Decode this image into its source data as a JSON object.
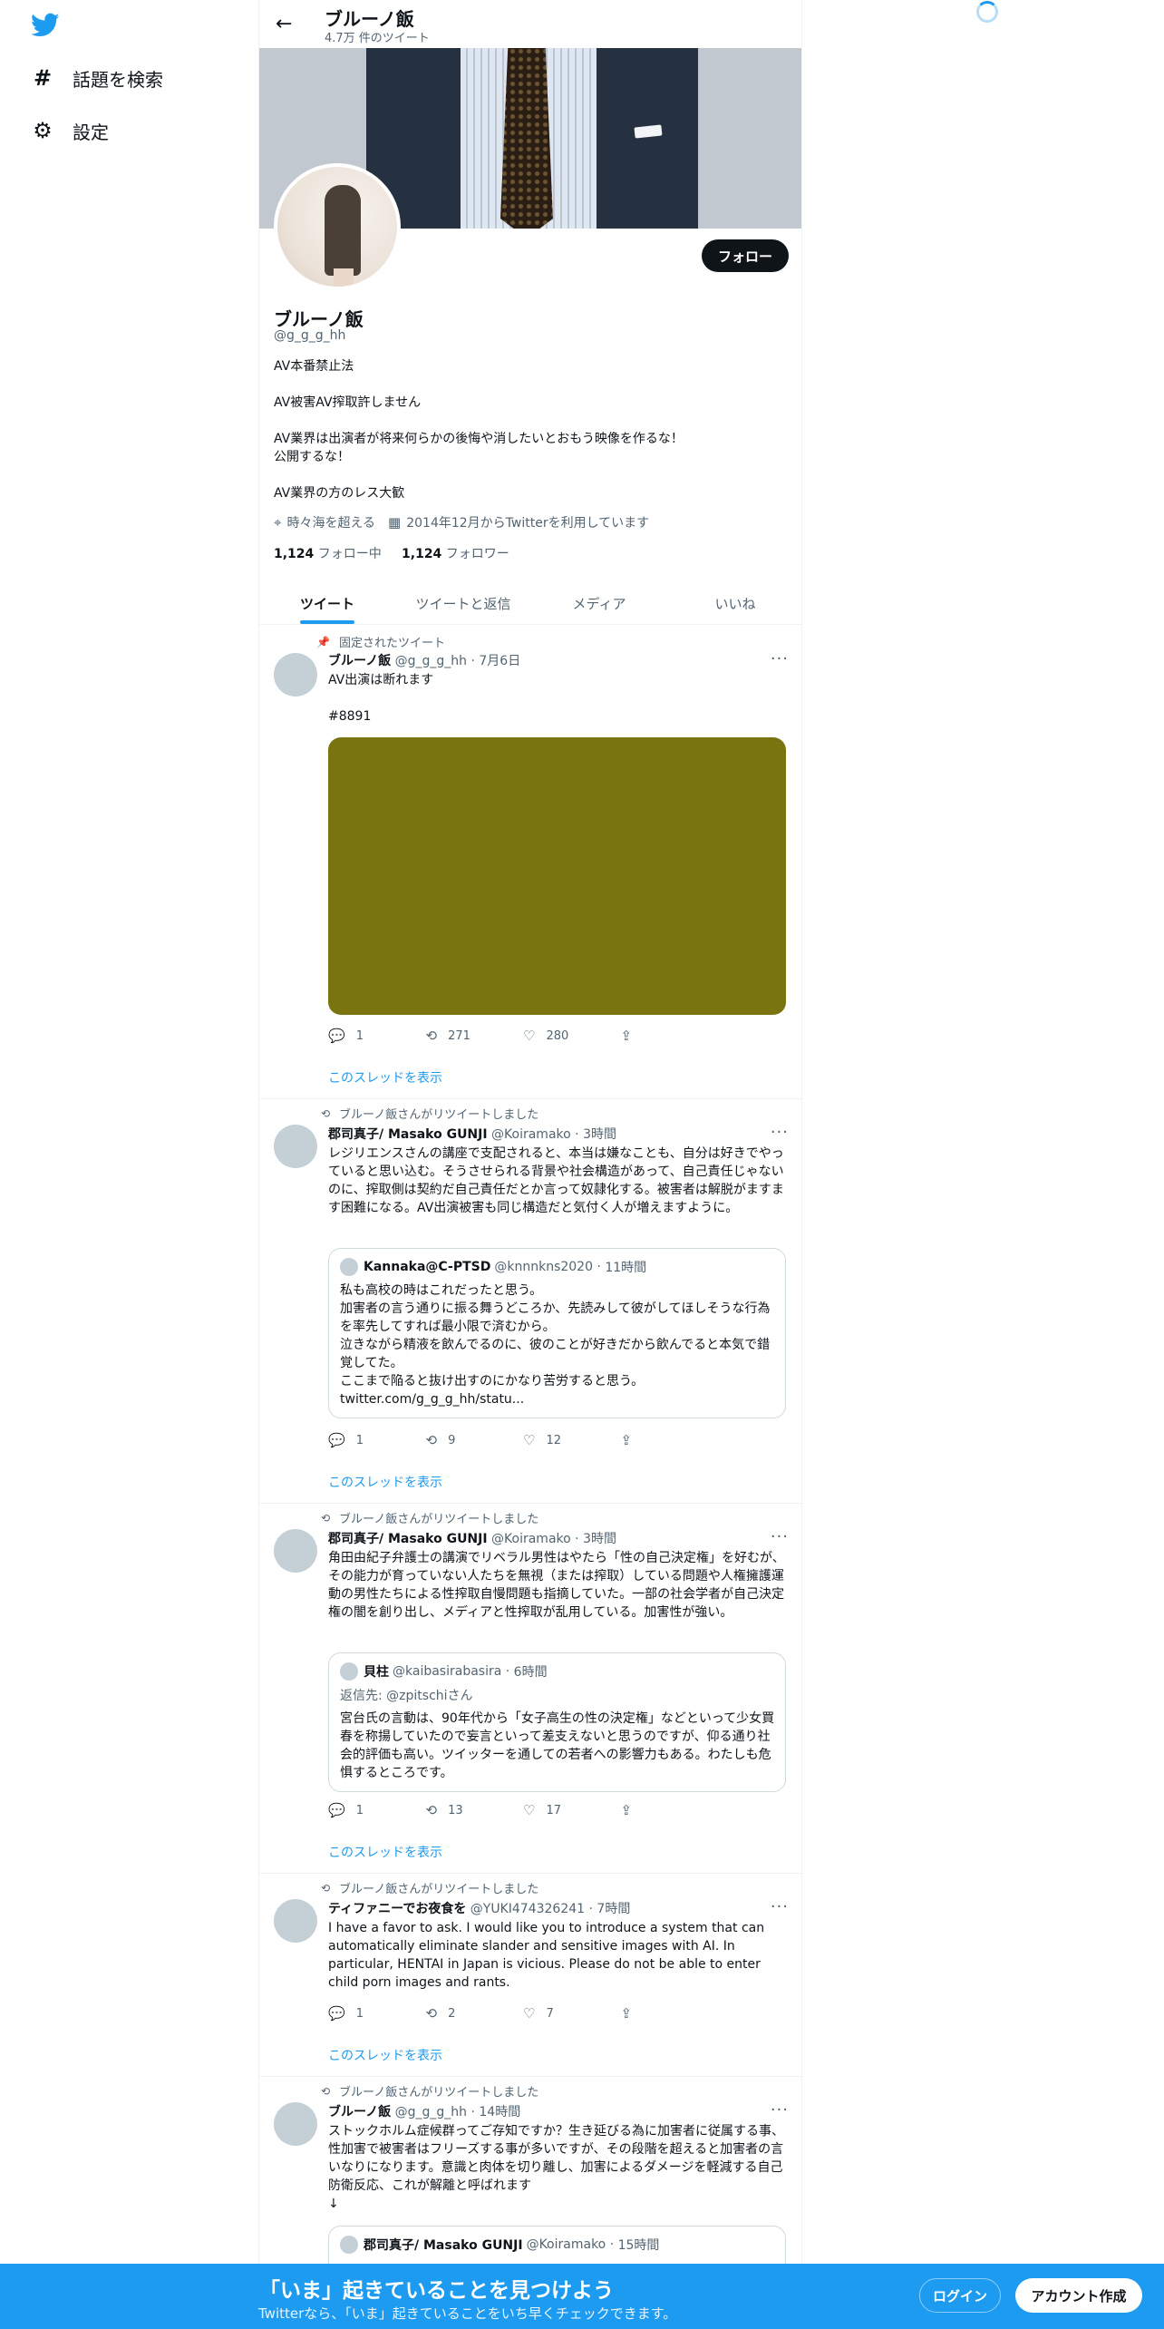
{
  "nav": {
    "explore_label": "話題を検索",
    "settings_label": "設定"
  },
  "header": {
    "name": "ブルーノ飯",
    "tweet_count": "4.7万 件のツイート"
  },
  "profile": {
    "name": "ブルーノ飯",
    "handle": "@g_g_g_hh",
    "follow_label": "フォロー",
    "bio": [
      "AV本番禁止法",
      "",
      "AV被害AV搾取許しません",
      "",
      "AV業界は出演者が将来何らかの後悔や消したいとおもう映像を作るな！",
      "公開するな！",
      "",
      "AV業界の方のレス大歓"
    ],
    "location": "時々海を超える",
    "joined": "2014年12月からTwitterを利用しています",
    "following_count": "1,124",
    "following_label": "フォロー中",
    "followers_count": "1,124",
    "followers_label": "フォロワー"
  },
  "tabs": [
    "ツイート",
    "ツイートと返信",
    "メディア",
    "いいね"
  ],
  "tweets": [
    {
      "social": "固定されたツイート",
      "name": "ブルーノ飯",
      "handle": "@g_g_g_hh",
      "time": "7月6日",
      "text": [
        "AV出演は断れます",
        "",
        "#8891"
      ],
      "replies": "1",
      "retweets": "271",
      "likes": "280",
      "thread": "このスレッドを表示"
    },
    {
      "social": "ブルーノ飯さんがリツイートしました",
      "name": "郡司真子/ Masako GUNJI",
      "handle": "@Koiramako",
      "time": "3時間",
      "text": [
        "レジリエンスさんの講座で支配されると、本当は嫌なことも、自分は好きでやっていると思い込む。そうさせられる背景や社会構造があって、自己責任じゃないのに、搾取側は契約だ自己責任だとか言って奴隷化する。被害者は解脱がますます困難になる。AV出演被害も同じ構造だと気付く人が増えますように。"
      ],
      "quote": {
        "name": "Kannaka@C-PTSD",
        "handle": "@knnnkns2020",
        "time": "11時間",
        "text": [
          "私も高校の時はこれだったと思う。",
          "加害者の言う通りに振る舞うどころか、先読みして彼がしてほしそうな行為を率先してすれば最小限で済むから。",
          "泣きながら精液を飲んでるのに、彼のことが好きだから飲んでると本気で錯覚してた。",
          "ここまで陥ると抜け出すのにかなり苦労すると思う。",
          "twitter.com/g_g_g_hh/statu..."
        ]
      },
      "replies": "1",
      "retweets": "9",
      "likes": "12",
      "thread": "このスレッドを表示"
    },
    {
      "social": "ブルーノ飯さんがリツイートしました",
      "name": "郡司真子/ Masako GUNJI",
      "handle": "@Koiramako",
      "time": "3時間",
      "text": [
        "角田由紀子弁護士の講演でリベラル男性はやたら「性の自己決定権」を好むが、その能力が育っていない人たちを無視（または搾取）している問題や人権擁護運動の男性たちによる性搾取自慢問題も指摘していた。一部の社会学者が自己決定権の闇を創り出し、メディアと性搾取が乱用している。加害性が強い。"
      ],
      "quote": {
        "name": "貝柱",
        "handle": "@kaibasirabasira",
        "time": "6時間",
        "reply_to": "返信先: @zpitschiさん",
        "text": [
          "宮台氏の言動は、90年代から「女子高生の性の決定権」などといって少女買春を称揚していたので妄言といって差支えないと思うのですが、仰る通り社会的評価も高い。ツイッターを通しての若者への影響力もある。わたしも危惧するところです。"
        ]
      },
      "replies": "1",
      "retweets": "13",
      "likes": "17",
      "thread": "このスレッドを表示"
    },
    {
      "social": "ブルーノ飯さんがリツイートしました",
      "name": "ティファニーでお夜食を",
      "handle": "@YUKI474326241",
      "time": "7時間",
      "text": [
        "I have a favor to ask. I would like you to introduce a system that can automatically eliminate slander and sensitive images with AI. In particular, HENTAI in Japan is vicious. Please do not be able to enter child porn images and rants."
      ],
      "replies": "1",
      "retweets": "2",
      "likes": "7",
      "thread": "このスレッドを表示"
    },
    {
      "social": "ブルーノ飯さんがリツイートしました",
      "name": "ブルーノ飯",
      "handle": "@g_g_g_hh",
      "time": "14時間",
      "text": [
        "ストックホルム症候群ってご存知ですか？生き延びる為に加害者に従属する事、性加害で被害者はフリーズする事が多いですが、その段階を超えると加害者の言いなりになります。意識と肉体を切り離し、加害によるダメージを軽減する自己防衛反応、これが解離と呼ばれます",
        "↓"
      ],
      "quote": {
        "name": "郡司真子/ Masako GUNJI",
        "handle": "@Koiramako",
        "time": "15時間"
      }
    }
  ],
  "bottom_bar": {
    "title": "「いま」起きていることを見つけよう",
    "subtitle": "Twitterなら、「いま」起きていることをいち早くチェックできます。",
    "login_label": "ログイン",
    "signup_label": "アカウント作成"
  },
  "colors": {
    "accent": "#1d9bf0",
    "text": "#0f1419",
    "secondary": "#536471",
    "media_fill": "#7a7410"
  }
}
